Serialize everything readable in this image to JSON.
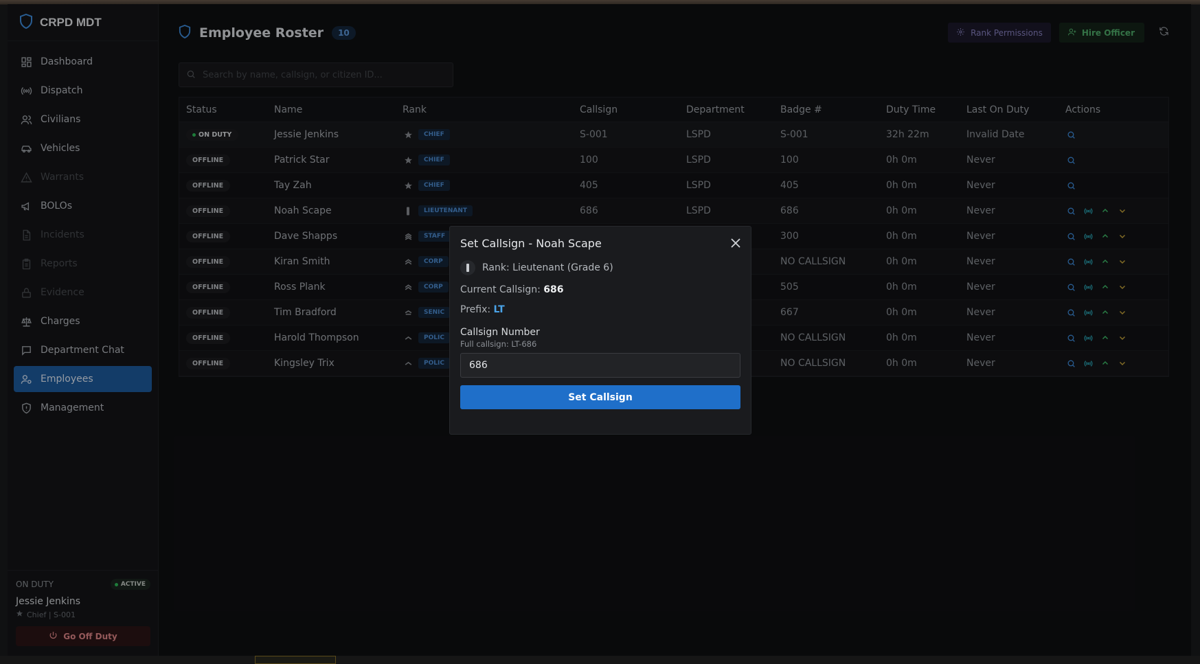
{
  "app": {
    "title": "CRPD MDT"
  },
  "sidebar": {
    "items": [
      {
        "label": "Dashboard",
        "icon": "dashboard-icon",
        "state": "normal"
      },
      {
        "label": "Dispatch",
        "icon": "radio-icon",
        "state": "normal"
      },
      {
        "label": "Civilians",
        "icon": "users-icon",
        "state": "normal"
      },
      {
        "label": "Vehicles",
        "icon": "car-icon",
        "state": "normal"
      },
      {
        "label": "Warrants",
        "icon": "warning-icon",
        "state": "disabled"
      },
      {
        "label": "BOLOs",
        "icon": "megaphone-icon",
        "state": "normal"
      },
      {
        "label": "Incidents",
        "icon": "file-icon",
        "state": "disabled"
      },
      {
        "label": "Reports",
        "icon": "clipboard-icon",
        "state": "disabled"
      },
      {
        "label": "Evidence",
        "icon": "lock-icon",
        "state": "disabled"
      },
      {
        "label": "Charges",
        "icon": "scale-icon",
        "state": "normal"
      },
      {
        "label": "Department Chat",
        "icon": "chat-icon",
        "state": "normal"
      },
      {
        "label": "Employees",
        "icon": "employees-icon",
        "state": "active"
      },
      {
        "label": "Management",
        "icon": "shield-icon",
        "state": "normal"
      }
    ],
    "footer": {
      "label": "ON DUTY",
      "badge": "ACTIVE",
      "name": "Jessie Jenkins",
      "sub": "Chief | S-001",
      "button": "Go Off Duty"
    }
  },
  "header": {
    "title": "Employee Roster",
    "count": "10",
    "rank_permissions": "Rank Permissions",
    "hire_officer": "Hire Officer"
  },
  "search": {
    "placeholder": "Search by name, callsign, or citizen ID..."
  },
  "table": {
    "columns": [
      "Status",
      "Name",
      "Rank",
      "Callsign",
      "Department",
      "Badge #",
      "Duty Time",
      "Last On Duty",
      "Actions"
    ],
    "rows": [
      {
        "status": "ON DUTY",
        "name": "Jessie Jenkins",
        "rank": "CHIEF",
        "callsign": "S-001",
        "department": "LSPD",
        "badge": "S-001",
        "duty": "32h 22m",
        "last": "Invalid Date",
        "full_actions": false
      },
      {
        "status": "OFFLINE",
        "name": "Patrick Star",
        "rank": "CHIEF",
        "callsign": "100",
        "department": "LSPD",
        "badge": "100",
        "duty": "0h 0m",
        "last": "Never",
        "full_actions": false
      },
      {
        "status": "OFFLINE",
        "name": "Tay Zah",
        "rank": "CHIEF",
        "callsign": "405",
        "department": "LSPD",
        "badge": "405",
        "duty": "0h 0m",
        "last": "Never",
        "full_actions": false
      },
      {
        "status": "OFFLINE",
        "name": "Noah Scape",
        "rank": "LIEUTENANT",
        "callsign": "686",
        "department": "LSPD",
        "badge": "686",
        "duty": "0h 0m",
        "last": "Never",
        "full_actions": true
      },
      {
        "status": "OFFLINE",
        "name": "Dave Shapps",
        "rank": "STAFF",
        "callsign": "",
        "department": "",
        "badge": "300",
        "duty": "0h 0m",
        "last": "Never",
        "full_actions": true
      },
      {
        "status": "OFFLINE",
        "name": "Kiran Smith",
        "rank": "CORP",
        "callsign": "",
        "department": "",
        "badge": "NO CALLSIGN",
        "duty": "0h 0m",
        "last": "Never",
        "full_actions": true
      },
      {
        "status": "OFFLINE",
        "name": "Ross Plank",
        "rank": "CORP",
        "callsign": "",
        "department": "",
        "badge": "505",
        "duty": "0h 0m",
        "last": "Never",
        "full_actions": true
      },
      {
        "status": "OFFLINE",
        "name": "Tim Bradford",
        "rank": "SENIC",
        "callsign": "",
        "department": "",
        "badge": "667",
        "duty": "0h 0m",
        "last": "Never",
        "full_actions": true
      },
      {
        "status": "OFFLINE",
        "name": "Harold Thompson",
        "rank": "POLIC",
        "callsign": "",
        "department": "",
        "badge": "NO CALLSIGN",
        "duty": "0h 0m",
        "last": "Never",
        "full_actions": true
      },
      {
        "status": "OFFLINE",
        "name": "Kingsley Trix",
        "rank": "POLIC",
        "callsign": "",
        "department": "",
        "badge": "NO CALLSIGN",
        "duty": "0h 0m",
        "last": "Never",
        "full_actions": true
      }
    ]
  },
  "modal": {
    "title": "Set Callsign - Noah Scape",
    "rank": "Rank: Lieutenant (Grade 6)",
    "current_label": "Current Callsign:",
    "current_value": "686",
    "prefix_label": "Prefix:",
    "prefix_value": "LT",
    "field_label": "Callsign Number",
    "full_callsign": "Full callsign: LT-686",
    "input_value": "686",
    "submit": "Set Callsign"
  },
  "colors": {
    "accent": "#1f6fc9",
    "active_nav": "#1e5ca0",
    "on_duty_dot": "#2fbf5a",
    "hire": "#50b06c",
    "rank_tag": "#4f8fd6"
  }
}
